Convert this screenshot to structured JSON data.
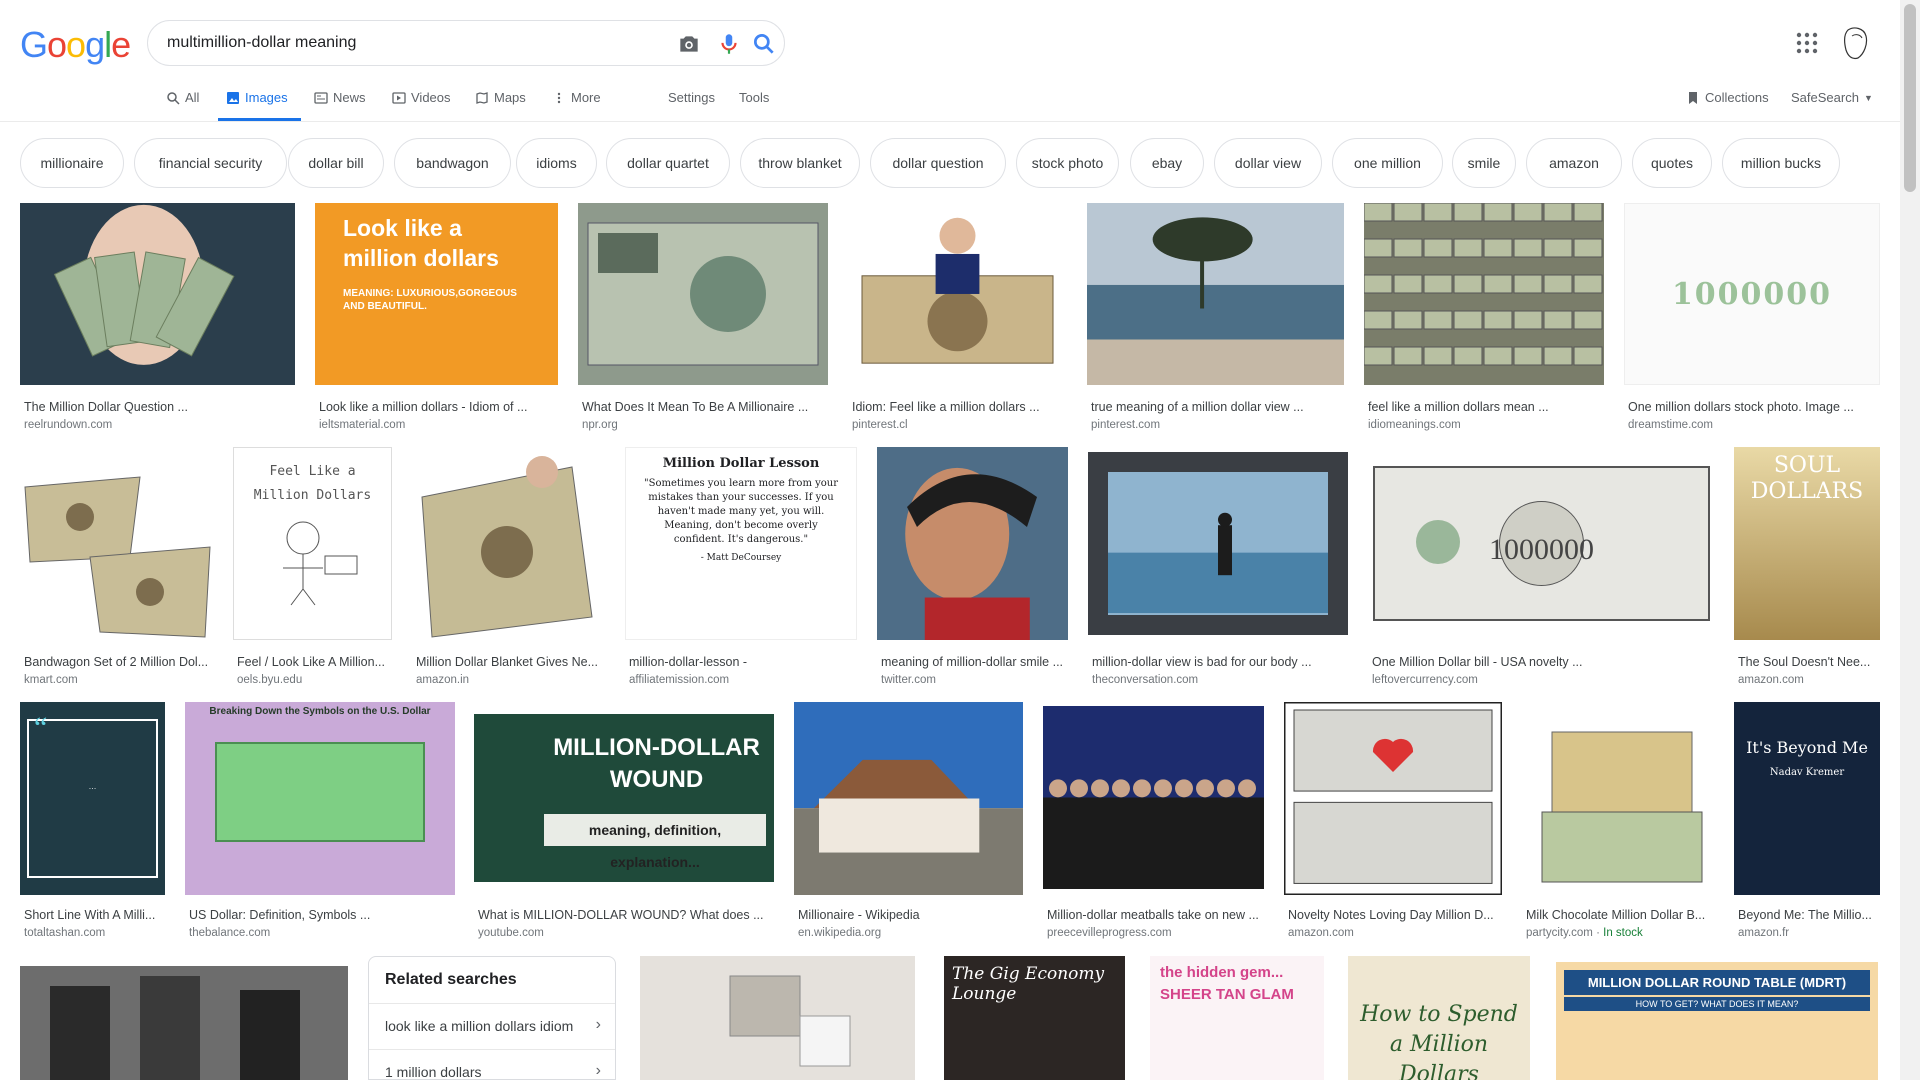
{
  "logo": [
    "G",
    "o",
    "o",
    "g",
    "l",
    "e"
  ],
  "search": {
    "query": "multimillion-dollar meaning"
  },
  "tabs": [
    {
      "label": "All",
      "icon": "search-icon"
    },
    {
      "label": "Images",
      "icon": "image-icon"
    },
    {
      "label": "News",
      "icon": "news-icon"
    },
    {
      "label": "Videos",
      "icon": "video-icon"
    },
    {
      "label": "Maps",
      "icon": "map-icon"
    },
    {
      "label": "More",
      "icon": "more-vert-icon"
    },
    {
      "label": "Settings"
    },
    {
      "label": "Tools"
    }
  ],
  "right_tools": {
    "collections": "Collections",
    "safesearch": "SafeSearch"
  },
  "chips": [
    "millionaire",
    "financial security",
    "dollar bill",
    "bandwagon",
    "idioms",
    "dollar quartet",
    "throw blanket",
    "dollar question",
    "stock photo",
    "ebay",
    "dollar view",
    "one million",
    "smile",
    "amazon",
    "quotes",
    "million bucks"
  ],
  "results": [
    {
      "caption": "The Million Dollar Question ...",
      "source": "reelrundown.com"
    },
    {
      "caption": "Look like a million dollars - Idiom of ...",
      "source": "ieltsmaterial.com",
      "thumb_title": "Look like a million dollars",
      "thumb_sub": "MEANING: LUXURIOUS,GORGEOUS AND BEAUTIFUL."
    },
    {
      "caption": "What Does It Mean To Be A Millionaire ...",
      "source": "npr.org"
    },
    {
      "caption": "Idiom: Feel like a million dollars ...",
      "source": "pinterest.cl"
    },
    {
      "caption": "true meaning of a million dollar view ...",
      "source": "pinterest.com"
    },
    {
      "caption": "feel like a million dollars mean ...",
      "source": "idiomeanings.com"
    },
    {
      "caption": "One million dollars stock photo. Image ...",
      "source": "dreamstime.com",
      "thumb_title": "1000000"
    },
    {
      "caption": "Bandwagon Set of 2 Million Dol...",
      "source": "kmart.com"
    },
    {
      "caption": "Feel / Look Like A Million...",
      "source": "oels.byu.edu",
      "thumb_title": "Feel Like a Million Dollars"
    },
    {
      "caption": "Million Dollar Blanket Gives Ne...",
      "source": "amazon.in"
    },
    {
      "caption": "million-dollar-lesson -",
      "source": "affiliatemission.com",
      "thumb_title": "Million Dollar Lesson",
      "thumb_sub": "\"Sometimes you learn more from your mistakes than your successes. If you haven't made many yet, you will. Meaning, don't become overly confident. It's dangerous.\"",
      "thumb_note": "- Matt DeCoursey"
    },
    {
      "caption": "meaning of million-dollar smile ...",
      "source": "twitter.com"
    },
    {
      "caption": "million-dollar view is bad for our body ...",
      "source": "theconversation.com"
    },
    {
      "caption": "One Million Dollar bill - USA novelty ...",
      "source": "leftovercurrency.com"
    },
    {
      "caption": "The Soul Doesn't Nee...",
      "source": "amazon.com",
      "thumb_title": "SOUL DOLLARS"
    },
    {
      "caption": "Short Line With A Milli...",
      "source": "totaltashan.com"
    },
    {
      "caption": "US Dollar: Definition, Symbols ...",
      "source": "thebalance.com",
      "thumb_title": "Breaking Down the Symbols on the U.S. Dollar"
    },
    {
      "caption": "What is MILLION-DOLLAR WOUND? What does ...",
      "source": "youtube.com",
      "thumb_title": "MILLION-DOLLAR WOUND",
      "thumb_sub": "meaning, definition, explanation..."
    },
    {
      "caption": "Millionaire - Wikipedia",
      "source": "en.wikipedia.org"
    },
    {
      "caption": "Million-dollar meatballs take on new ...",
      "source": "preecevilleprogress.com"
    },
    {
      "caption": "Novelty Notes Loving Day Million D...",
      "source": "amazon.com"
    },
    {
      "caption": "Milk Chocolate Million Dollar B...",
      "source": "partycity.com",
      "stock": "In stock"
    },
    {
      "caption": "Beyond Me: The Millio...",
      "source": "amazon.fr",
      "thumb_title": "It's Beyond Me",
      "thumb_sub": "Nadav Kremer"
    }
  ],
  "related": {
    "title": "Related searches",
    "items": [
      "look like a million dollars idiom",
      "1 million dollars"
    ]
  },
  "bottom_tiles": [
    {
      "name": "vintage-photo"
    },
    {
      "name": "cards-photo"
    },
    {
      "name": "gig-economy",
      "thumb_title": "The Gig Economy Lounge"
    },
    {
      "name": "sheer-tan",
      "thumb_title": "the hidden gem... SHEER TAN GLAM"
    },
    {
      "name": "spend-million",
      "thumb_title": "How to Spend a Million Dollars"
    },
    {
      "name": "mdrt",
      "thumb_title": "MILLION DOLLAR ROUND TABLE (MDRT)",
      "thumb_sub": "HOW TO GET? WHAT DOES IT MEAN?"
    }
  ],
  "colors": {
    "accent": "#1a73e8",
    "chip_border": "#dfe1e5"
  }
}
